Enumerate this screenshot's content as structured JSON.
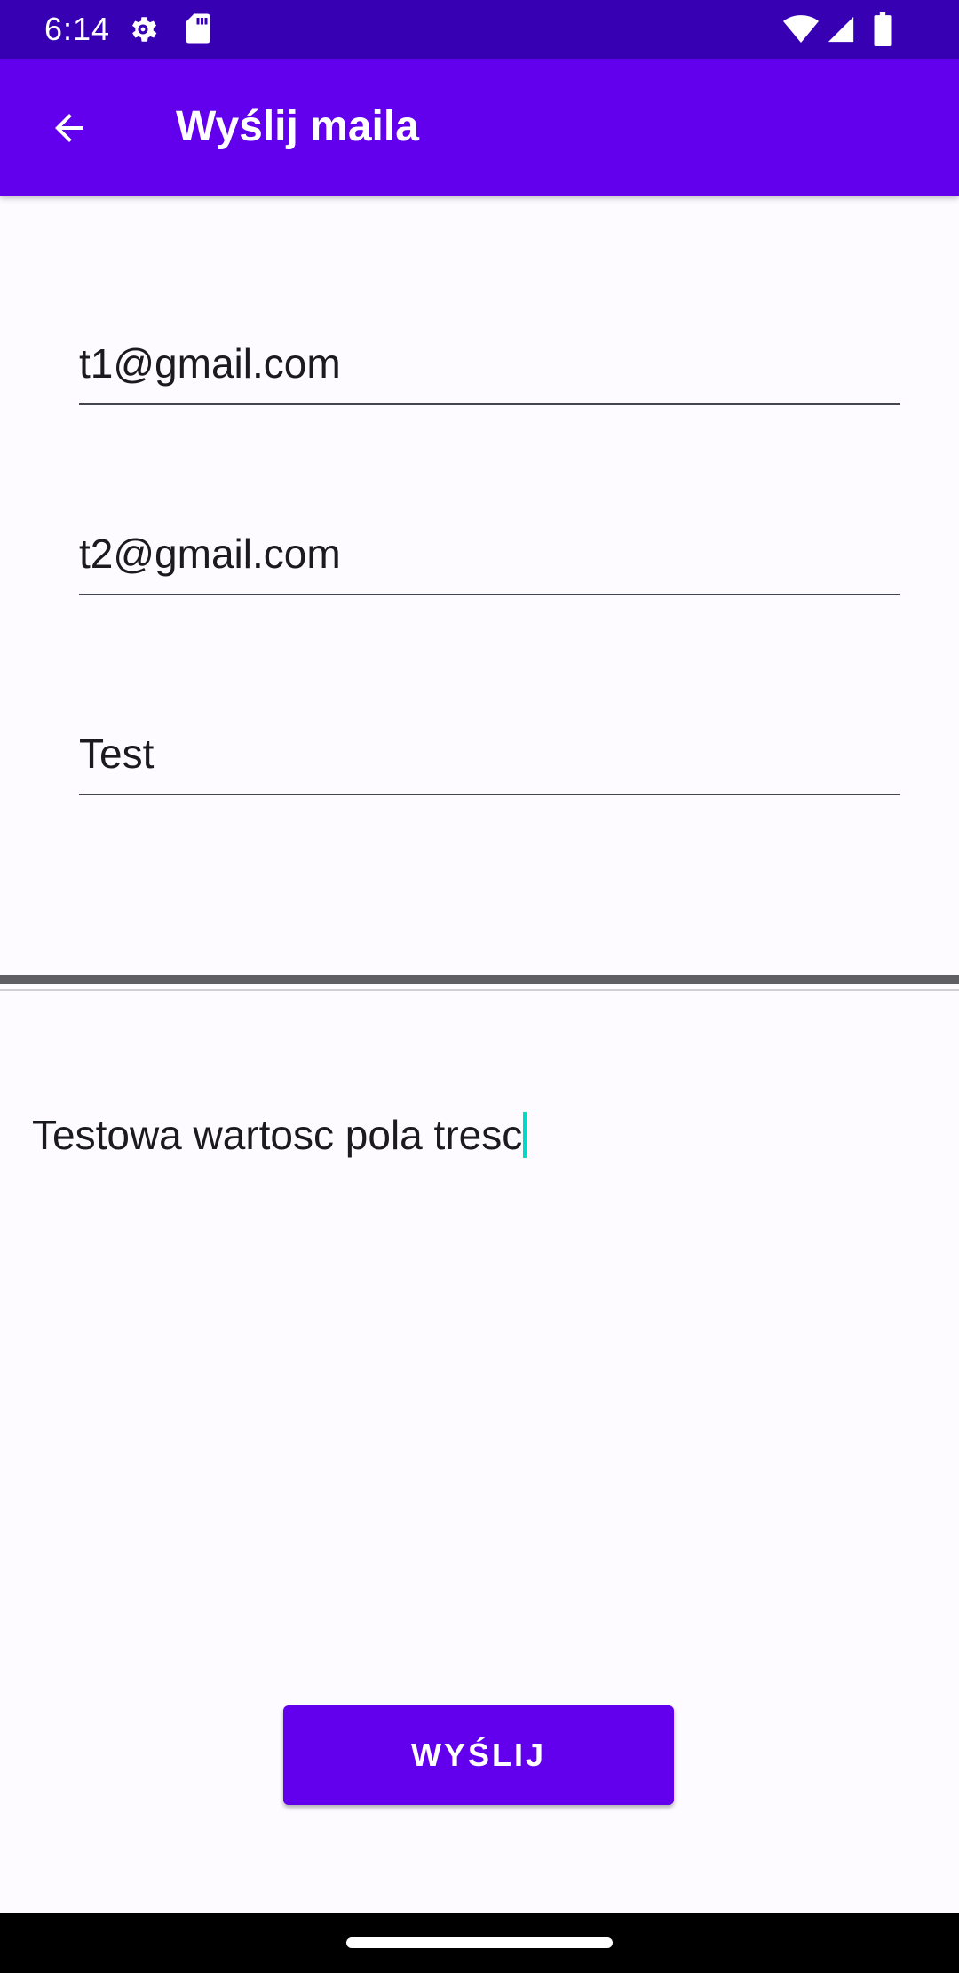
{
  "status_bar": {
    "time": "6:14",
    "icons": [
      "gear-icon",
      "sd-card-icon",
      "wifi-icon",
      "signal-icon",
      "battery-icon"
    ]
  },
  "app_bar": {
    "title": "Wyślij maila",
    "back_icon": "arrow-back-icon"
  },
  "form": {
    "to_value": "t1@gmail.com",
    "cc_value": "t2@gmail.com",
    "subject_value": "Test",
    "body_value": "Testowa wartosc pola tresc"
  },
  "send_button": {
    "label": "WYŚLIJ"
  },
  "colors": {
    "status_bar": "#3700b3",
    "primary": "#6200ee",
    "background": "#fdfbff",
    "caret": "#03dac5",
    "nav_bar": "#000000"
  }
}
